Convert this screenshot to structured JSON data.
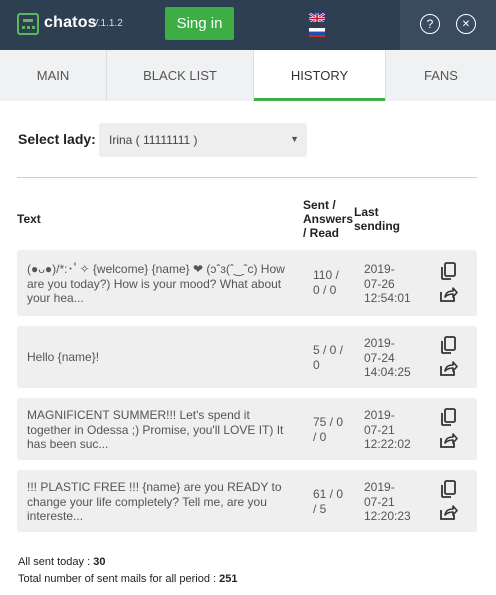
{
  "header": {
    "brand": "chatos",
    "version": "V.1.1.2",
    "signin_label": "Sing in",
    "help_label": "?",
    "close_label": "✕",
    "accent": "#3cae44",
    "background": "#2f3f52"
  },
  "tabs": [
    {
      "label": "MAIN",
      "active": false
    },
    {
      "label": "BLACK LIST",
      "active": false
    },
    {
      "label": "HISTORY",
      "active": true
    },
    {
      "label": "FANS",
      "active": false
    }
  ],
  "select": {
    "label": "Select lady:",
    "value": "Irina ( 11111111 )"
  },
  "table": {
    "columns": {
      "text": "Text",
      "stats": [
        "Sent /",
        "Answers",
        "/ Read"
      ],
      "last_sending": [
        "Last",
        "sending"
      ]
    },
    "rows": [
      {
        "text": "(●ᴗ●)/*:･ﾟ✧ {welcome} {name} ❤ (ↄˆɜ(ˆ‿ˆc) How are you today?) How is your mood? What about your hea...",
        "stats": "110 / 0 / 0",
        "date": [
          "2019-",
          "07-26",
          "12:54:01"
        ]
      },
      {
        "text": "Hello {name}!",
        "stats": "5 / 0 / 0",
        "date": [
          "2019-",
          "07-24",
          "14:04:25"
        ]
      },
      {
        "text": "MAGNIFICENT SUMMER!!! Let's spend it together in Odessa ;) Promise, you'll LOVE IT) It has been suc...",
        "stats": "75 / 0 / 0",
        "date": [
          "2019-",
          "07-21",
          "12:22:02"
        ]
      },
      {
        "text": "!!! PLASTIC FREE !!! {name} are you READY to change your life completely? Tell me, are you intereste...",
        "stats": "61 / 0 / 5",
        "date": [
          "2019-",
          "07-21",
          "12:20:23"
        ]
      }
    ]
  },
  "footer": {
    "sent_today_label": "All sent today : ",
    "sent_today_value": "30",
    "total_label": "Total number of sent mails for all period : ",
    "total_value": "251"
  }
}
